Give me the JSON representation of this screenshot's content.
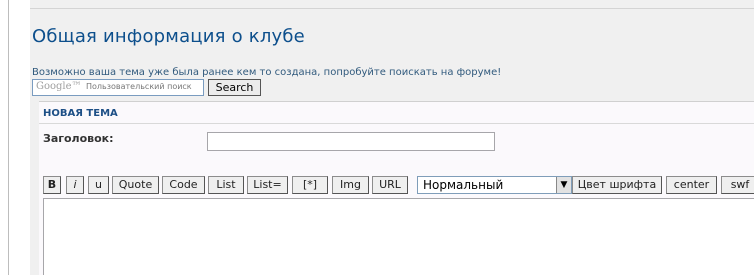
{
  "page": {
    "title": "Общая информация о клубе",
    "hint": "Возможно ваша тема уже была ранее кем то создана, попробуйте поискать на форуме!"
  },
  "search": {
    "logo": "Google™",
    "placeholder": "Пользовательский поиск",
    "button_label": "Search"
  },
  "form": {
    "section_title": "НОВАЯ ТЕМА",
    "subject_label": "Заголовок:",
    "subject_value": ""
  },
  "toolbar": {
    "buttons": [
      "B",
      "i",
      "u",
      "Quote",
      "Code",
      "List",
      "List=",
      "[*]",
      "Img",
      "URL"
    ],
    "font_size_value": "Нормальный",
    "buttons_after": [
      "Цвет шрифта",
      "center",
      "swf"
    ]
  }
}
